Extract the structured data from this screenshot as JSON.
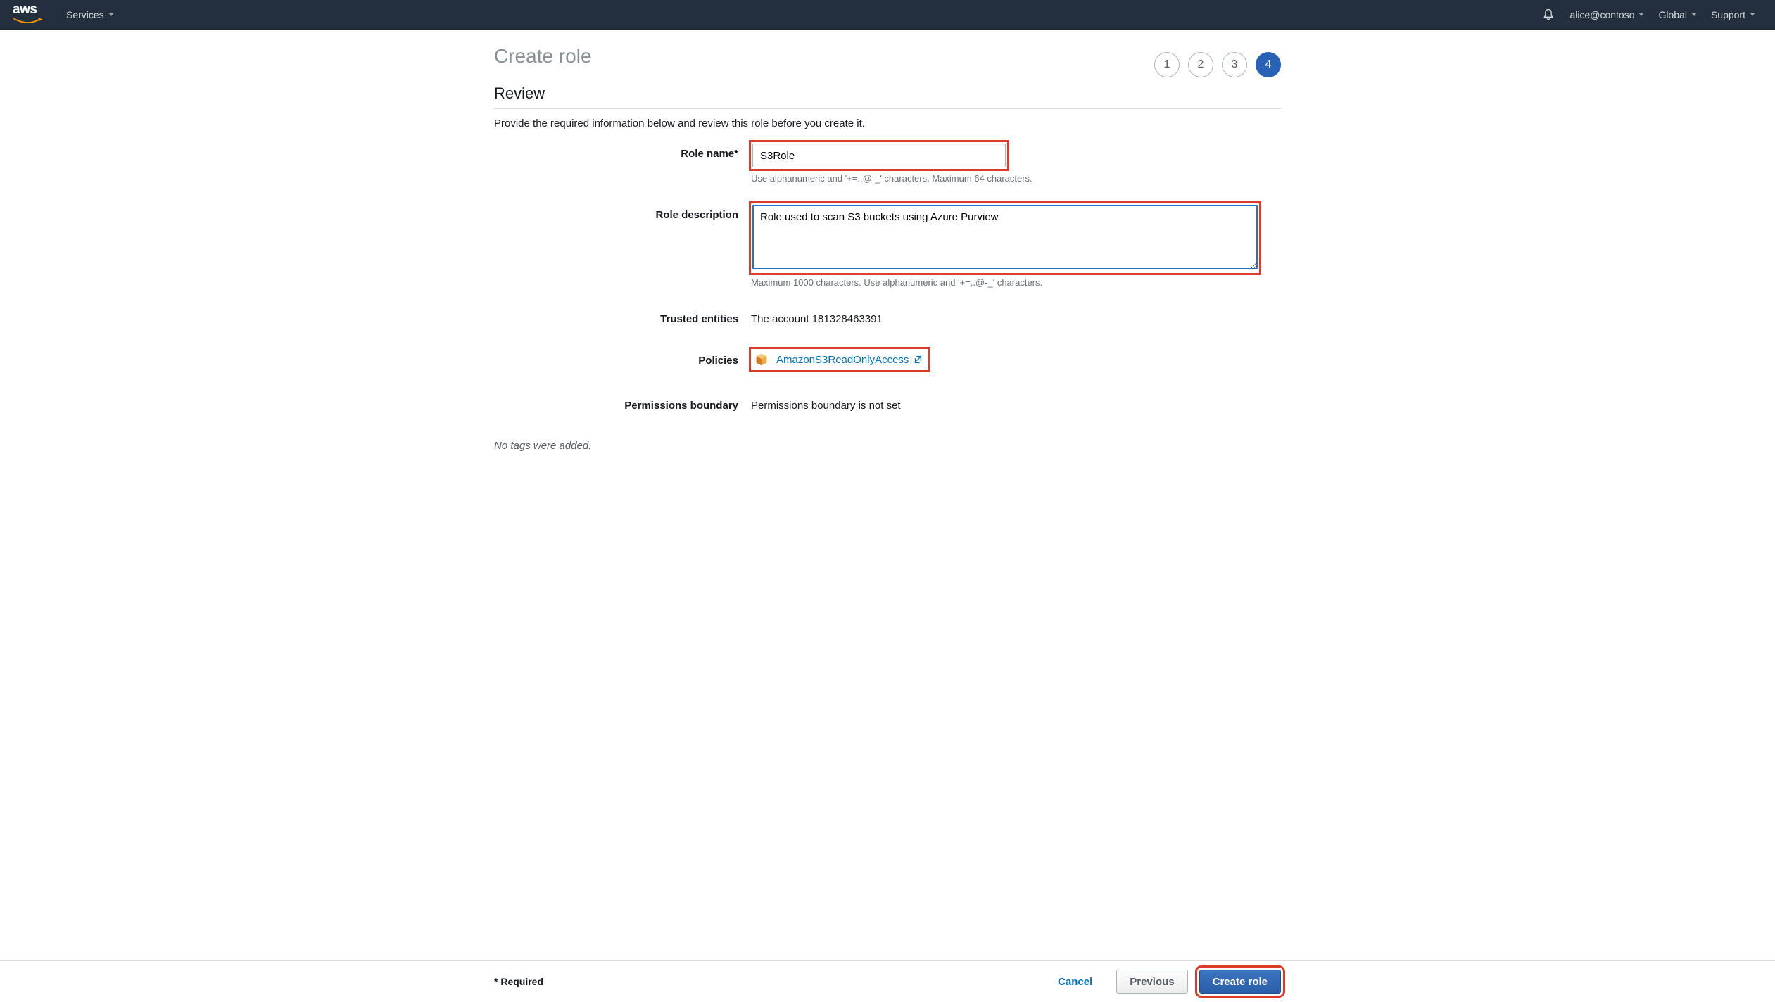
{
  "nav": {
    "services": "Services",
    "account": "alice@contoso",
    "region": "Global",
    "support": "Support"
  },
  "page": {
    "title": "Create role",
    "steps": [
      "1",
      "2",
      "3",
      "4"
    ],
    "active_step": 4,
    "section_heading": "Review",
    "section_sub": "Provide the required information below and review this role before you create it."
  },
  "form": {
    "role_name": {
      "label": "Role name*",
      "value": "S3Role",
      "hint": "Use alphanumeric and '+=,.@-_' characters. Maximum 64 characters."
    },
    "role_description": {
      "label": "Role description",
      "value": "Role used to scan S3 buckets using Azure Purview",
      "hint": "Maximum 1000 characters. Use alphanumeric and '+=,.@-_' characters."
    },
    "trusted_entities": {
      "label": "Trusted entities",
      "value": "The account 181328463391"
    },
    "policies": {
      "label": "Policies",
      "link_text": "AmazonS3ReadOnlyAccess"
    },
    "permissions_boundary": {
      "label": "Permissions boundary",
      "value": "Permissions boundary is not set"
    },
    "no_tags": "No tags were added."
  },
  "footer": {
    "required": "* Required",
    "cancel": "Cancel",
    "previous": "Previous",
    "create_role": "Create role"
  }
}
